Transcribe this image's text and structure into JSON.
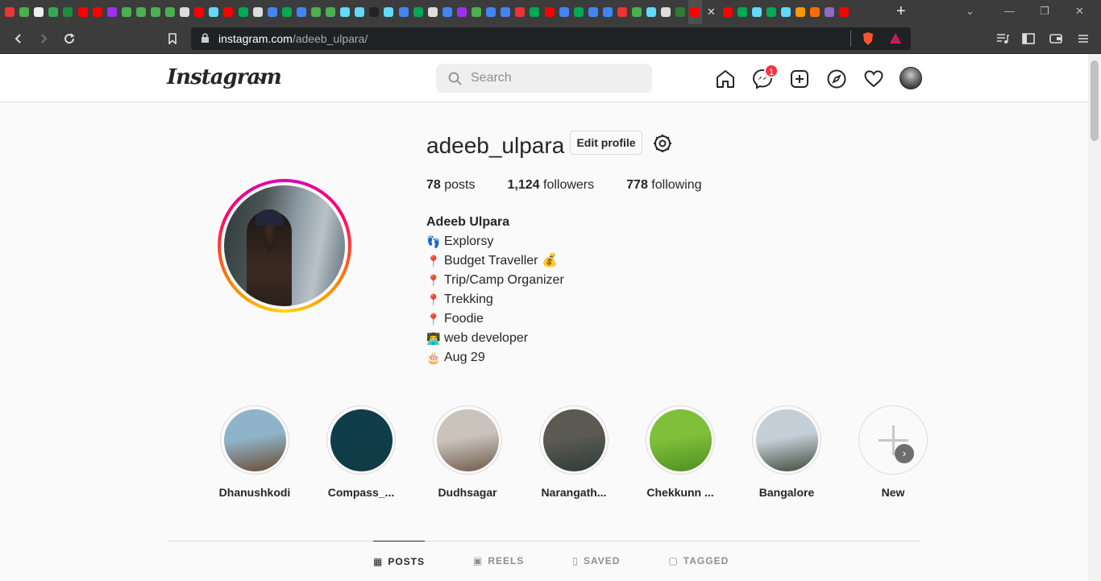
{
  "browser": {
    "url_host": "instagram.com",
    "url_path": "/adeeb_ulpara/",
    "tab_favicon_colors": [
      "#e33",
      "#4caf50",
      "#eee",
      "#34a853",
      "#1e8e3e",
      "#f00",
      "#f00",
      "#a030f0",
      "#4caf50",
      "#4caf50",
      "#4caf50",
      "#4caf50",
      "#ddd",
      "#f00",
      "#61dafb",
      "#f00",
      "#0a5",
      "#ddd",
      "#4285f4",
      "#0a5",
      "#4285f4",
      "#4caf50",
      "#4caf50",
      "#61dafb",
      "#61dafb",
      "#222",
      "#61dafb",
      "#4285f4",
      "#0a5",
      "#ddd",
      "#4285f4",
      "#a030f0",
      "#4caf50",
      "#4285f4",
      "#4285f4",
      "#e33",
      "#0a5",
      "#f00",
      "#4285f4",
      "#0a5",
      "#4285f4",
      "#4285f4",
      "#e33",
      "#4caf50",
      "#61dafb",
      "#ddd",
      "#2e7d32",
      "#f00",
      "#f00",
      "#0a5",
      "#61dafb",
      "#0a5",
      "#61dafb",
      "#f90",
      "#ff6d00",
      "#8e6bc7",
      "#f00"
    ]
  },
  "nav": {
    "logo": "Instagram",
    "search_placeholder": "Search",
    "messages_badge": "1"
  },
  "profile": {
    "username": "adeeb_ulpara",
    "edit_label": "Edit profile",
    "stats": [
      {
        "count": "78",
        "label": "posts"
      },
      {
        "count": "1,124",
        "label": "followers"
      },
      {
        "count": "778",
        "label": "following"
      }
    ],
    "name": "Adeeb Ulpara",
    "bio": [
      {
        "emoji": "👣",
        "text": "Explorsy"
      },
      {
        "emoji": "📍",
        "text": "Budget Traveller 💰"
      },
      {
        "emoji": "📍",
        "text": " Trip/Camp Organizer"
      },
      {
        "emoji": "📍",
        "text": "Trekking"
      },
      {
        "emoji": "📍",
        "text": "Foodie"
      },
      {
        "emoji": "👨‍💻",
        "text": " web developer"
      },
      {
        "emoji": "🎂",
        "text": "Aug 29"
      }
    ]
  },
  "highlights": [
    {
      "label": "Dhanushkodi",
      "color1": "#8fb3c9",
      "color2": "#6b4a2e"
    },
    {
      "label": "Compass_...",
      "color1": "#0f3d4a",
      "color2": "#123a44"
    },
    {
      "label": "Dudhsagar",
      "color1": "#c9c3bb",
      "color2": "#6e5a4a"
    },
    {
      "label": "Narangath...",
      "color1": "#5b5a52",
      "color2": "#2f3b3a"
    },
    {
      "label": "Chekkunn ...",
      "color1": "#7fbf3a",
      "color2": "#4e8e22"
    },
    {
      "label": "Bangalore",
      "color1": "#c5cfd8",
      "color2": "#3e4a3c"
    },
    {
      "label": "New",
      "color1": "#fafafa",
      "color2": "#fafafa"
    }
  ],
  "profile_tabs": [
    {
      "label": "POSTS",
      "icon": "grid-icon"
    },
    {
      "label": "REELS",
      "icon": "reels-icon"
    },
    {
      "label": "SAVED",
      "icon": "bookmark-icon"
    },
    {
      "label": "TAGGED",
      "icon": "tag-icon"
    }
  ]
}
